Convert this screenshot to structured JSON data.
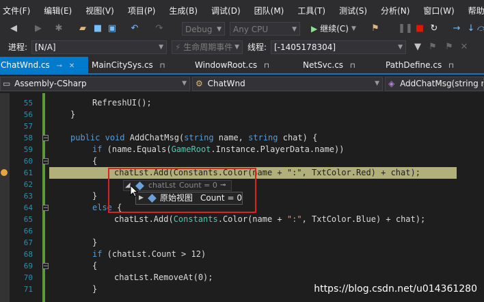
{
  "menubar": {
    "items": [
      "文件(F)",
      "编辑(E)",
      "视图(V)",
      "项目(P)",
      "生成(B)",
      "调试(D)",
      "团队(M)",
      "工具(T)",
      "测试(S)",
      "分析(N)",
      "窗口(W)",
      "帮助(H)"
    ]
  },
  "toolbar": {
    "config": "Debug",
    "platform": "Any CPU",
    "run_label": "继续(C)"
  },
  "debugbar": {
    "process_label": "进程:",
    "process_value": "[N/A]",
    "lifecycle_label": "生命周期事件",
    "thread_label": "线程:",
    "thread_value": "[-1405178304]"
  },
  "tabs": [
    {
      "label": "ChatWnd.cs",
      "active": true
    },
    {
      "label": "MainCitySys.cs",
      "active": false
    },
    {
      "label": "WindowRoot.cs",
      "active": false
    },
    {
      "label": "NetSvc.cs",
      "active": false
    },
    {
      "label": "PathDefine.cs",
      "active": false
    }
  ],
  "navbar": {
    "project": "Assembly-CSharp",
    "class": "ChatWnd",
    "member": "AddChatMsg(string n"
  },
  "code": {
    "line_numbers": [
      "55",
      "56",
      "57",
      "58",
      "59",
      "60",
      "61",
      "62",
      "63",
      "64",
      "65",
      "66",
      "67",
      "68",
      "69",
      "70",
      "71"
    ],
    "l55": "RefreshUI();",
    "l56": "}",
    "l58_kw1": "public",
    "l58_kw2": "void",
    "l58_name": " AddChatMsg(",
    "l58_kw3": "string",
    "l58_p1": " name, ",
    "l58_kw4": "string",
    "l58_p2": " chat) {",
    "l59_kw": "if",
    "l59_a": " (name.Equals(",
    "l59_ty": "GameRoot",
    "l59_b": ".Instance.PlayerData.name))",
    "l60": "{",
    "l61_a": "chatLst.Add(Constants.Color(name + \":\", TxtColor.Red) + chat);",
    "l63": "}",
    "l64_kw": "else",
    "l64_b": " {",
    "l65_a": "chatLst.Add(",
    "l65_ty": "Constants",
    "l65_b": ".Color(name + ",
    "l65_st": "\":\"",
    "l65_c": ", TxtColor.Blue) + chat);",
    "l67": "}",
    "l68_kw": "if",
    "l68_a": " (chatLst.Count > 12)",
    "l69": "{",
    "l70": "chatLst.RemoveAt(0);",
    "l71": "}"
  },
  "datatip": {
    "var_name": "chatLst",
    "var_count": "Count = 0",
    "raw_view": "原始视图",
    "raw_count": "Count = 0"
  },
  "watermark": "https://blog.csdn.net/u014361280",
  "colors": {
    "accent": "#007acc",
    "highlight": "#b2b07a",
    "annotation_box": "#e02020"
  }
}
